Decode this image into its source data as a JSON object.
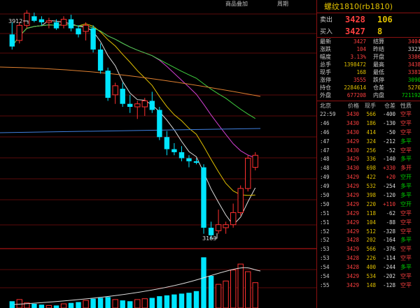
{
  "chart": {
    "top_links": [
      "商品叠加",
      "周期"
    ],
    "high_label": "3912",
    "low_label": "3163",
    "colors": {
      "up": "#ff3030",
      "down": "#00e5ff",
      "ma1": "#dddddd",
      "ma2": "#e0c000",
      "ma3": "#d040d0",
      "ma4": "#40d040",
      "ma5": "#e08030",
      "ma6": "#4080e0"
    },
    "icons": [
      "arrow-icon"
    ]
  },
  "chart_data": {
    "type": "candlestick",
    "ohlc": [
      [
        3840,
        3880,
        3790,
        3800
      ],
      [
        3820,
        3880,
        3810,
        3870
      ],
      [
        3870,
        3920,
        3860,
        3910
      ],
      [
        3900,
        3912,
        3880,
        3885
      ],
      [
        3890,
        3900,
        3870,
        3880
      ],
      [
        3880,
        3895,
        3860,
        3885
      ],
      [
        3880,
        3890,
        3855,
        3860
      ],
      [
        3870,
        3900,
        3860,
        3890
      ],
      [
        3890,
        3905,
        3850,
        3860
      ],
      [
        3860,
        3870,
        3830,
        3840
      ],
      [
        3850,
        3880,
        3820,
        3870
      ],
      [
        3860,
        3870,
        3780,
        3790
      ],
      [
        3790,
        3810,
        3710,
        3720
      ],
      [
        3720,
        3730,
        3620,
        3630
      ],
      [
        3640,
        3680,
        3610,
        3670
      ],
      [
        3660,
        3680,
        3600,
        3610
      ],
      [
        3610,
        3640,
        3580,
        3600
      ],
      [
        3600,
        3620,
        3560,
        3610
      ],
      [
        3600,
        3630,
        3570,
        3620
      ],
      [
        3620,
        3650,
        3580,
        3590
      ],
      [
        3590,
        3600,
        3490,
        3500
      ],
      [
        3500,
        3520,
        3440,
        3460
      ],
      [
        3460,
        3480,
        3440,
        3450
      ],
      [
        3450,
        3470,
        3420,
        3430
      ],
      [
        3430,
        3440,
        3400,
        3420
      ],
      [
        3420,
        3430,
        3410,
        3415
      ],
      [
        3400,
        3410,
        3180,
        3200
      ],
      [
        3200,
        3220,
        3163,
        3175
      ],
      [
        3190,
        3260,
        3180,
        3210
      ],
      [
        3200,
        3220,
        3180,
        3210
      ],
      [
        3210,
        3280,
        3200,
        3250
      ],
      [
        3250,
        3340,
        3240,
        3330
      ],
      [
        3330,
        3440,
        3320,
        3430
      ],
      [
        3400,
        3450,
        3390,
        3440
      ]
    ],
    "volume": [
      8,
      10,
      6,
      5,
      4,
      3,
      3,
      5,
      6,
      7,
      9,
      11,
      12,
      13,
      10,
      9,
      8,
      10,
      11,
      12,
      14,
      15,
      16,
      17,
      18,
      20,
      60,
      38,
      28,
      32,
      45,
      52,
      43,
      30
    ]
  },
  "panel": {
    "title": "螺纹1810(rb1810)",
    "sell": {
      "label": "卖出",
      "price": "3428",
      "vol": "106"
    },
    "buy": {
      "label": "买入",
      "price": "3427",
      "vol": "8"
    },
    "stats": [
      {
        "l1": "最新",
        "v1": "3427",
        "c1": "red",
        "l2": "结算",
        "v2": "3404",
        "c2": "red"
      },
      {
        "l1": "涨跌",
        "v1": "104",
        "c1": "red",
        "l2": "昨结",
        "v2": "3323",
        "c2": "white"
      },
      {
        "l1": "幅度",
        "v1": "3.13%",
        "c1": "red",
        "l2": "开盘",
        "v2": "3386",
        "c2": "red"
      },
      {
        "l1": "总手",
        "v1": "1398472",
        "c1": "yellow",
        "l2": "最高",
        "v2": "3438",
        "c2": "red"
      },
      {
        "l1": "现手",
        "v1": "168",
        "c1": "yellow",
        "l2": "最低",
        "v2": "3381",
        "c2": "red"
      },
      {
        "l1": "涨停",
        "v1": "3555",
        "c1": "red",
        "l2": "跌停",
        "v2": "3090",
        "c2": "green"
      },
      {
        "l1": "持仓",
        "v1": "2284614",
        "c1": "yellow",
        "l2": "仓差",
        "v2": "5270",
        "c2": "yellow"
      },
      {
        "l1": "外盘",
        "v1": "677208",
        "c1": "red",
        "l2": "内盘",
        "v2": "721192",
        "c2": "green"
      }
    ],
    "tick_headers": [
      "北京",
      "价格",
      "现手",
      "仓差",
      "性质"
    ],
    "ticks": [
      {
        "time": "22:59",
        "price": "3430",
        "vol": "566",
        "chg": "-400",
        "nat": "空平",
        "cc": "white",
        "nc": "red"
      },
      {
        "time": ":46",
        "price": "3430",
        "vol": "186",
        "chg": "-130",
        "nat": "空平",
        "cc": "white",
        "nc": "red"
      },
      {
        "time": ":46",
        "price": "3430",
        "vol": "414",
        "chg": "-50",
        "nat": "空平",
        "cc": "white",
        "nc": "red"
      },
      {
        "time": ":47",
        "price": "3429",
        "vol": "324",
        "chg": "-212",
        "nat": "多平",
        "cc": "white",
        "nc": "green"
      },
      {
        "time": ":47",
        "price": "3430",
        "vol": "256",
        "chg": "-52",
        "nat": "空平",
        "cc": "white",
        "nc": "red"
      },
      {
        "time": ":48",
        "price": "3429",
        "vol": "336",
        "chg": "-140",
        "nat": "多平",
        "cc": "white",
        "nc": "green"
      },
      {
        "time": ":48",
        "price": "3430",
        "vol": "698",
        "chg": "+330",
        "nat": "多开",
        "cc": "white",
        "nc": "red"
      },
      {
        "time": ":49",
        "price": "3429",
        "vol": "422",
        "chg": "+20",
        "nat": "空开",
        "cc": "white",
        "nc": "green"
      },
      {
        "time": ":49",
        "price": "3429",
        "vol": "532",
        "chg": "-254",
        "nat": "多平",
        "cc": "white",
        "nc": "green"
      },
      {
        "time": ":50",
        "price": "3429",
        "vol": "398",
        "chg": "-120",
        "nat": "多平",
        "cc": "white",
        "nc": "green"
      },
      {
        "time": ":50",
        "price": "3429",
        "vol": "220",
        "chg": "+110",
        "nat": "空开",
        "cc": "white",
        "nc": "green"
      },
      {
        "time": ":51",
        "price": "3429",
        "vol": "118",
        "chg": "-62",
        "nat": "空平",
        "cc": "white",
        "nc": "red"
      },
      {
        "time": ":51",
        "price": "3429",
        "vol": "104",
        "chg": "-88",
        "nat": "空平",
        "cc": "white",
        "nc": "red"
      },
      {
        "time": ":52",
        "price": "3429",
        "vol": "512",
        "chg": "-328",
        "nat": "空平",
        "cc": "white",
        "nc": "red"
      },
      {
        "time": ":52",
        "price": "3428",
        "vol": "202",
        "chg": "-164",
        "nat": "多平",
        "cc": "white",
        "nc": "green"
      },
      {
        "time": ":53",
        "price": "3429",
        "vol": "566",
        "chg": "-376",
        "nat": "空平",
        "cc": "white",
        "nc": "red"
      },
      {
        "time": ":53",
        "price": "3428",
        "vol": "226",
        "chg": "-114",
        "nat": "空平",
        "cc": "white",
        "nc": "red"
      },
      {
        "time": ":54",
        "price": "3428",
        "vol": "400",
        "chg": "-244",
        "nat": "多平",
        "cc": "white",
        "nc": "green"
      },
      {
        "time": ":54",
        "price": "3429",
        "vol": "534",
        "chg": "-202",
        "nat": "空平",
        "cc": "white",
        "nc": "red"
      },
      {
        "time": ":55",
        "price": "3429",
        "vol": "148",
        "chg": "-128",
        "nat": "空平",
        "cc": "white",
        "nc": "red"
      }
    ]
  }
}
